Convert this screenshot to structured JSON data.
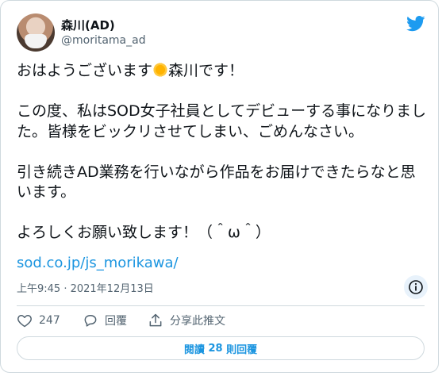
{
  "author": {
    "name": "森川(AD)",
    "handle": "@moritama_ad"
  },
  "tweet": {
    "line1_before": "おはようございます",
    "line1_emoji": "sun-with-face-emoji",
    "line1_after": "森川です！",
    "para2": "この度、私はSOD女子社員としてデビューする事になりました。皆様をビックリさせてしまい、ごめんなさい。",
    "para3": "引き続きAD業務を行いながら作品をお届けできたらなと思います。",
    "para4": "よろしくお願い致します！（＾ω＾）",
    "link": "sod.co.jp/js_morikawa/"
  },
  "timestamp": "上午9:45 · 2021年12月13日",
  "actions": {
    "like_count": "247",
    "reply_label": "回覆",
    "share_label": "分享此推文"
  },
  "replies_button": {
    "prefix": "閱讀",
    "count": "28",
    "suffix": "則回覆"
  },
  "colors": {
    "accent": "#1b95e0",
    "text": "#0f1419",
    "muted": "#536471",
    "border": "#cfd9de"
  }
}
